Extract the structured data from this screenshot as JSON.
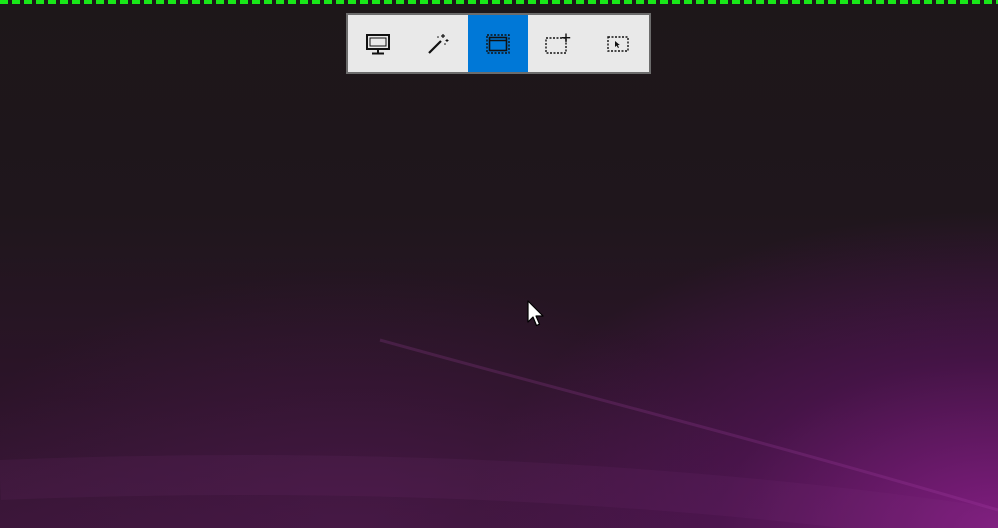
{
  "capture_border": {
    "color": "#19e619",
    "style": "dashed"
  },
  "toolbar": {
    "active_color": "#0078d7",
    "background_color": "#e9e9e9",
    "buttons": [
      {
        "name": "fullscreen-capture",
        "icon": "monitor-icon",
        "active": false
      },
      {
        "name": "auto-capture",
        "icon": "magic-wand-icon",
        "active": false
      },
      {
        "name": "window-capture",
        "icon": "window-icon",
        "active": true
      },
      {
        "name": "add-region-capture",
        "icon": "dashed-rect-plus-icon",
        "active": false
      },
      {
        "name": "region-capture",
        "icon": "dashed-rect-cursor-icon",
        "active": false
      }
    ]
  },
  "desktop": {
    "wallpaper_colors": [
      "#1d1719",
      "#3a1638",
      "#8c1e8c"
    ]
  },
  "mouse_pointer": {
    "icon": "arrow-cursor-icon"
  }
}
